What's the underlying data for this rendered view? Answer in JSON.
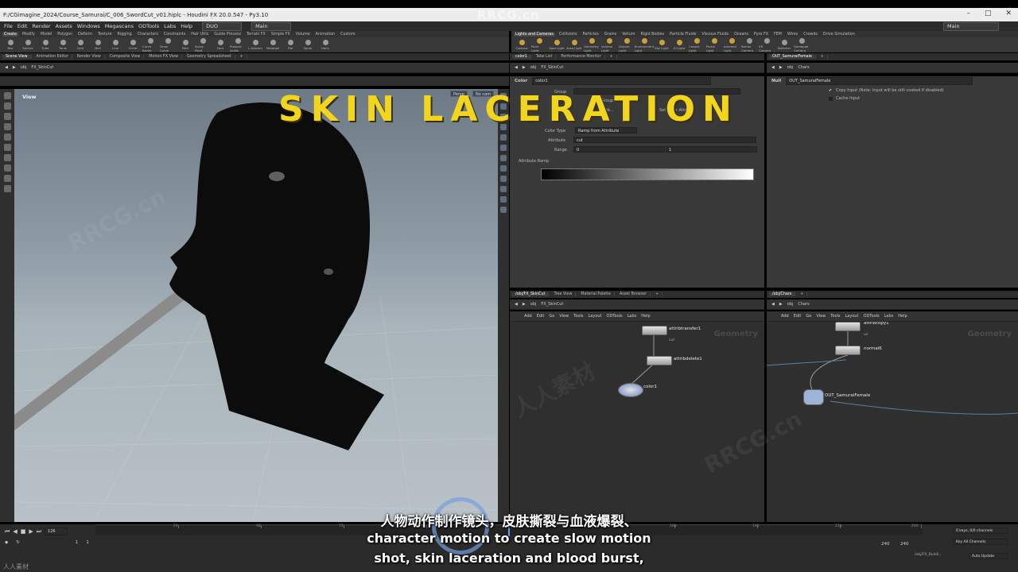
{
  "window": {
    "title": "F:/CGimagine_2024/Course_Samurai/C_006_SwordCut_v01.hiplc - Houdini FX 20.0.547 - Py3.10"
  },
  "menu": {
    "items": [
      "File",
      "Edit",
      "Render",
      "Assets",
      "Windows",
      "Megascans",
      "ODTools",
      "Labs",
      "Help"
    ],
    "desktop": "DUO",
    "main": "Main"
  },
  "shelf_left": {
    "tabs": [
      "Create",
      "Modify",
      "Model",
      "Polygon",
      "Deform",
      "Texture",
      "Rigging",
      "Characters",
      "Constraints",
      "Hair Utils",
      "Guide Process",
      "Terrain FX",
      "Simple FX",
      "Volume",
      "Animation",
      "Custom"
    ],
    "tools": [
      "Box",
      "Sphere",
      "Tube",
      "Torus",
      "Grid",
      "Null",
      "Line",
      "Circle",
      "Curve Bezier",
      "Draw Curve",
      "Path",
      "Spray Paint",
      "Font",
      "Platonic Solids",
      "L-System",
      "Metaball",
      "File",
      "Spiral",
      "Helix"
    ]
  },
  "shelf_right": {
    "tabs": [
      "Lights and Cameras",
      "Collisions",
      "Particles",
      "Grains",
      "Vellum",
      "Rigid Bodies",
      "Particle Fluids",
      "Viscous Fluids",
      "Oceans",
      "Pyro FX",
      "FEM",
      "Wires",
      "Crowds",
      "Drive Simulation"
    ],
    "tools": [
      "Camera",
      "Point Light",
      "Spot Light",
      "Area Light",
      "Geometry Light",
      "Volume Light",
      "Distant Light",
      "Environment Light",
      "Sky Light",
      "GI Light",
      "Caustic Light",
      "Portal Light",
      "Ambient Light",
      "Stereo Camera",
      "VR Camera",
      "Switcher",
      "Gamepad Camera"
    ]
  },
  "scene": {
    "tabs": [
      "Scene View",
      "Animation Editor",
      "Render View",
      "Composite View",
      "Motion FX View",
      "Geometry Spreadsheet"
    ],
    "path": [
      "obj",
      "FX_SkinCut"
    ],
    "view_label": "View",
    "badges": [
      "Persp",
      "No cam"
    ]
  },
  "params": {
    "tabs": [
      "color1",
      "Take List",
      "Performance Monitor"
    ],
    "path": [
      "obj",
      "FX_SkinCut"
    ],
    "node_type": "Color",
    "node_name": "color1",
    "group_label": "Group",
    "group_type": "Group",
    "class_hint": "Attrib...",
    "set_color_hint": "Set Color Attrib...",
    "color_type_label": "Color Type",
    "color_type": "Ramp from Attribute",
    "attribute_label": "Attribute",
    "attribute": "cut",
    "range_label": "Range",
    "range_min": "0",
    "range_max": "1",
    "ramp_label": "Attribute Ramp"
  },
  "rparams": {
    "tabs": [
      "OUT_SamuraiFemale"
    ],
    "path": [
      "obj",
      "Chars"
    ],
    "node_type": "Null",
    "node_name": "OUT_SamuraiFemale",
    "copy_input": "Copy Input (Note: Input will be still cooked if disabled)",
    "cache_input": "Cache Input"
  },
  "network_left": {
    "tabs": [
      "/obj/FX_SkinCut",
      "Tree View",
      "Material Palette",
      "Asset Browser"
    ],
    "path": [
      "obj",
      "FX_SkinCut"
    ],
    "menu": [
      "Add",
      "Edit",
      "Go",
      "View",
      "Tools",
      "Layout",
      "ODTools",
      "Labs",
      "Help"
    ],
    "watermark": "Geometry",
    "nodes": [
      {
        "name": "attribtransfer1",
        "sub": "cut"
      },
      {
        "name": "attribdelete1",
        "sub": ""
      },
      {
        "name": "color1",
        "sub": ""
      }
    ]
  },
  "network_right": {
    "tabs": [
      "/obj/Chars"
    ],
    "path": [
      "obj",
      "Chars"
    ],
    "menu": [
      "Add",
      "Edit",
      "Go",
      "View",
      "Tools",
      "Layout",
      "ODTools",
      "Labs",
      "Help"
    ],
    "watermark": "Geometry",
    "nodes": [
      {
        "name": "attribcopy1",
        "sub": "uv"
      },
      {
        "name": "normal6",
        "sub": ""
      },
      {
        "name": "OUT_SamuraiFemale",
        "sub": ""
      }
    ]
  },
  "timeline": {
    "frame": "126",
    "start": "1",
    "start2": "1",
    "end": "240",
    "end2": "240",
    "ticks": [
      "24",
      "48",
      "72",
      "96",
      "120",
      "144",
      "168",
      "192",
      "216",
      "240"
    ],
    "keys": "0 keys, 0/0 channels",
    "key_all": "Key All Channels",
    "auto_update": "Auto Update",
    "status_path": "/obj/FX_Buildi..."
  },
  "overlay": {
    "title": "SKIN LACERATION",
    "subtitle_cn": "人物动作制作镜头，皮肤撕裂与血液爆裂、",
    "subtitle_en1": "character motion to create slow motion",
    "subtitle_en2": "shot, skin laceration and blood burst,",
    "watermark": "RRCG.cn",
    "corner": "人人素材"
  },
  "colors": {
    "title_yellow": "#f2d61d",
    "panel": "#393939",
    "network": "#2f2f2f"
  }
}
